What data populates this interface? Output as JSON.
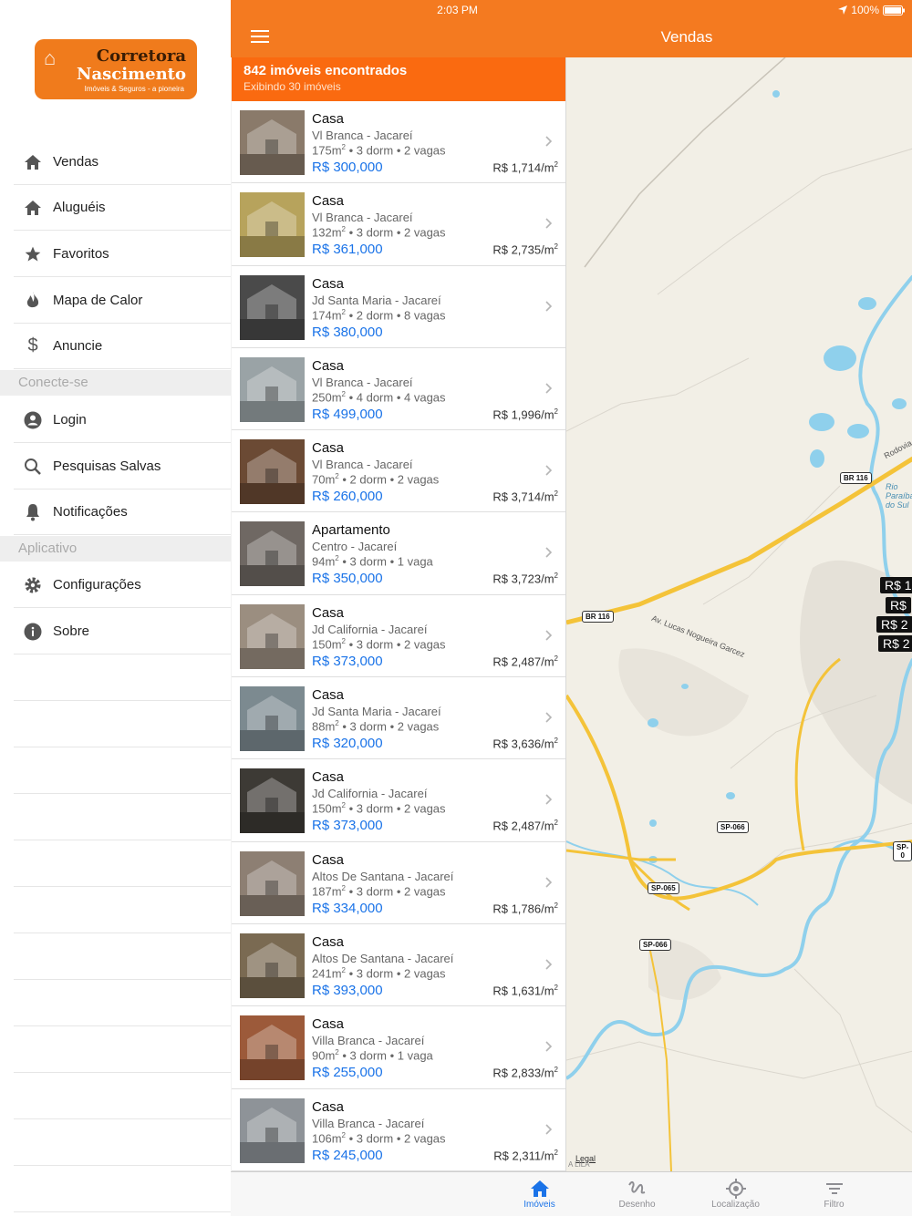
{
  "status": {
    "time": "2:03 PM",
    "battery": "100%"
  },
  "nav": {
    "title": "Vendas"
  },
  "logo": {
    "line1": "Corretora",
    "line2": "Nascimento",
    "line3": "Imóveis & Seguros - a pioneira"
  },
  "menu": {
    "items": [
      {
        "label": "Vendas",
        "icon": "home-icon"
      },
      {
        "label": "Aluguéis",
        "icon": "home-icon"
      },
      {
        "label": "Favoritos",
        "icon": "star-icon"
      },
      {
        "label": "Mapa de Calor",
        "icon": "flame-icon"
      },
      {
        "label": "Anuncie",
        "icon": "dollar-icon"
      }
    ],
    "section_connect": "Conecte-se",
    "connect_items": [
      {
        "label": "Login",
        "icon": "account-icon"
      },
      {
        "label": "Pesquisas Salvas",
        "icon": "search-icon"
      },
      {
        "label": "Notificações",
        "icon": "bell-icon"
      }
    ],
    "section_app": "Aplicativo",
    "app_items": [
      {
        "label": "Configurações",
        "icon": "gear-icon"
      },
      {
        "label": "Sobre",
        "icon": "info-icon"
      }
    ]
  },
  "summary": {
    "count": "842 imóveis encontrados",
    "showing": "Exibindo 30 imóveis"
  },
  "listings": [
    {
      "type": "Casa",
      "location": "Vl Branca - Jacareí",
      "area": "175m",
      "details": " • 3 dorm • 2 vagas",
      "price": "R$ 300,000",
      "ppm": "R$ 1,714/m",
      "color": "#8a7a6a"
    },
    {
      "type": "Casa",
      "location": "Vl Branca - Jacareí",
      "area": "132m",
      "details": " • 3 dorm • 2 vagas",
      "price": "R$ 361,000",
      "ppm": "R$ 2,735/m",
      "color": "#b7a35c"
    },
    {
      "type": "Casa",
      "location": "Jd Santa Maria - Jacareí",
      "area": "174m",
      "details": " • 2 dorm • 8 vagas",
      "price": "R$ 380,000",
      "ppm": "",
      "color": "#4a4a4a"
    },
    {
      "type": "Casa",
      "location": "Vl Branca - Jacareí",
      "area": "250m",
      "details": " • 4 dorm • 4 vagas",
      "price": "R$ 499,000",
      "ppm": "R$ 1,996/m",
      "color": "#9aa3a6"
    },
    {
      "type": "Casa",
      "location": "Vl Branca - Jacareí",
      "area": "70m",
      "details": " • 2 dorm • 2 vagas",
      "price": "R$ 260,000",
      "ppm": "R$ 3,714/m",
      "color": "#6b4a34"
    },
    {
      "type": "Apartamento",
      "location": "Centro - Jacareí",
      "area": "94m",
      "details": " • 3 dorm • 1 vaga",
      "price": "R$ 350,000",
      "ppm": "R$ 3,723/m",
      "color": "#6f6863"
    },
    {
      "type": "Casa",
      "location": "Jd California - Jacareí",
      "area": "150m",
      "details": " • 3 dorm • 2 vagas",
      "price": "R$ 373,000",
      "ppm": "R$ 2,487/m",
      "color": "#9b8e80"
    },
    {
      "type": "Casa",
      "location": "Jd Santa Maria - Jacareí",
      "area": "88m",
      "details": " • 3 dorm • 2 vagas",
      "price": "R$ 320,000",
      "ppm": "R$ 3,636/m",
      "color": "#7c8a90"
    },
    {
      "type": "Casa",
      "location": "Jd California - Jacareí",
      "area": "150m",
      "details": " • 3 dorm • 2 vagas",
      "price": "R$ 373,000",
      "ppm": "R$ 2,487/m",
      "color": "#3d3a35"
    },
    {
      "type": "Casa",
      "location": "Altos De Santana - Jacareí",
      "area": "187m",
      "details": " • 3 dorm • 2 vagas",
      "price": "R$ 334,000",
      "ppm": "R$ 1,786/m",
      "color": "#8d7f73"
    },
    {
      "type": "Casa",
      "location": "Altos De Santana - Jacareí",
      "area": "241m",
      "details": " • 3 dorm • 2 vagas",
      "price": "R$ 393,000",
      "ppm": "R$ 1,631/m",
      "color": "#7a6a52"
    },
    {
      "type": "Casa",
      "location": "Villa Branca - Jacareí",
      "area": "90m",
      "details": " • 3 dorm • 1 vaga",
      "price": "R$ 255,000",
      "ppm": "R$ 2,833/m",
      "color": "#9c5a3a"
    },
    {
      "type": "Casa",
      "location": "Villa Branca - Jacareí",
      "area": "106m",
      "details": " • 3 dorm • 2 vagas",
      "price": "R$ 245,000",
      "ppm": "R$ 2,311/m",
      "color": "#8e9398"
    }
  ],
  "map": {
    "pins": [
      "R$ 1",
      "R$",
      "R$ 2",
      "R$ 2"
    ],
    "shields": [
      "BR 116",
      "BR 116",
      "SP-066",
      "SP-065",
      "SP-066",
      "SP-0"
    ],
    "labels": [
      "Av. Lucas Nogueira Garcez",
      "Rodovia",
      "Rio Paraíba do Sul",
      "Legal",
      "A LILA"
    ]
  },
  "tabs": [
    {
      "label": "Imóveis",
      "icon": "home-icon",
      "active": true
    },
    {
      "label": "Desenho",
      "icon": "draw-icon",
      "active": false
    },
    {
      "label": "Localização",
      "icon": "location-icon",
      "active": false
    },
    {
      "label": "Filtro",
      "icon": "filter-icon",
      "active": false
    }
  ]
}
